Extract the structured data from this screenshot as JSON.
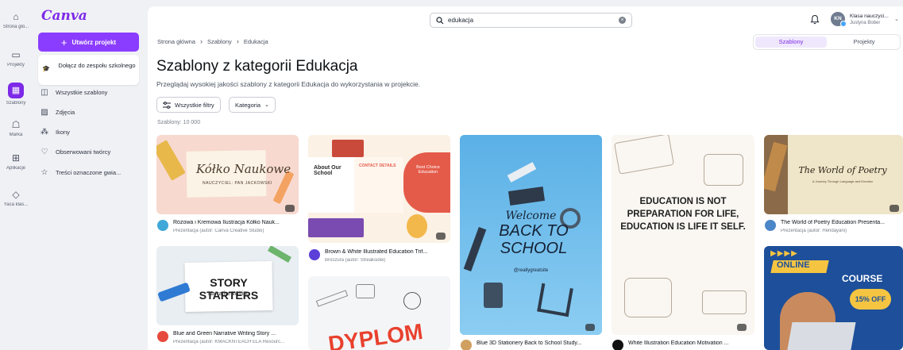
{
  "rail": [
    {
      "icon": "home-icon",
      "label": "Strona głó...",
      "glyph": "⌂"
    },
    {
      "icon": "folder-icon",
      "label": "Projekty",
      "glyph": "▭"
    },
    {
      "icon": "templates-icon",
      "label": "Szablony",
      "glyph": "▦",
      "active": true
    },
    {
      "icon": "brand-icon",
      "label": "Marka",
      "glyph": "☖"
    },
    {
      "icon": "apps-icon",
      "label": "Aplikacje",
      "glyph": "⊞"
    },
    {
      "icon": "class-icon",
      "label": "Yaca klas...",
      "glyph": "◇"
    }
  ],
  "panel": {
    "logo": "Canva",
    "create_label": "Utwórz projekt",
    "team_label": "Dołącz do zespołu szkolnego",
    "nav": [
      {
        "icon": "all-templates-icon",
        "glyph": "◫",
        "label": "Wszystkie szablony"
      },
      {
        "icon": "photos-icon",
        "glyph": "▨",
        "label": "Zdjęcia"
      },
      {
        "icon": "icons-icon",
        "glyph": "⁂",
        "label": "Ikony"
      },
      {
        "icon": "followed-creators-icon",
        "glyph": "♡",
        "label": "Obserwowani twórcy"
      },
      {
        "icon": "star-icon",
        "glyph": "☆",
        "label": "Treści oznaczone gwia..."
      }
    ]
  },
  "search": {
    "value": "edukacja"
  },
  "account": {
    "initials": "KN",
    "name": "Klasa nauczyci...",
    "user": "Justyna Bober"
  },
  "breadcrumb": [
    "Strona główna",
    "Szablony",
    "Edukacja"
  ],
  "segment": {
    "templates": "Szablony",
    "projects": "Projekty"
  },
  "page": {
    "title": "Szablony z kategorii Edukacja",
    "subtitle": "Przeglądaj wysokiej jakości szablony z kategorii Edukacja do wykorzystania w projekcie.",
    "all_filters": "Wszystkie filtry",
    "category": "Kategoria",
    "count": "Szablony: 10 000"
  },
  "cards": [
    {
      "title": "Różowa i Kremowa Ilustracja Kółko Nauk...",
      "sub": "Prezentacja (autor: Canva Creative Studio)",
      "text": "Kółko Naukowe",
      "text2": "NAUCZYCIEL: PAN JACKOWSKI"
    },
    {
      "title": "Blue and Green Narrative Writing Story ...",
      "sub": "Prezentacja (autor: KMACKNTEACH ELA Resourc...",
      "text": "STORY STARTERS",
      "text2": "Narrative Writing"
    },
    {
      "title": "Brown & White Illustrated Education Trif...",
      "sub": "Broszura (autor: Streaksidei)",
      "text": "About Our School",
      "text2": "CONTACT DETAILS",
      "text3": "Best Choice Education"
    },
    {
      "title": "",
      "sub": "",
      "text": "DYPLOM"
    },
    {
      "title": "Blue 3D Stationery Back to School Study...",
      "sub": "",
      "text": "Welcome",
      "text2": "BACK TO SCHOOL",
      "text3": "@reallygreatsite"
    },
    {
      "title": "White Illustration Education Motivation ...",
      "sub": "",
      "text": "EDUCATION IS NOT PREPARATION FOR LIFE, EDUCATION IS LIFE IT SELF."
    },
    {
      "title": "The World of Poetry Education Presenta...",
      "sub": "Prezentacja (autor: Hendayani)",
      "text": "The World of Poetry",
      "text2": "A Journey Through Language and Emotion"
    },
    {
      "title": "",
      "sub": "",
      "text": "ONLINE",
      "text2": "COURSE",
      "text3": "15% OFF"
    }
  ]
}
